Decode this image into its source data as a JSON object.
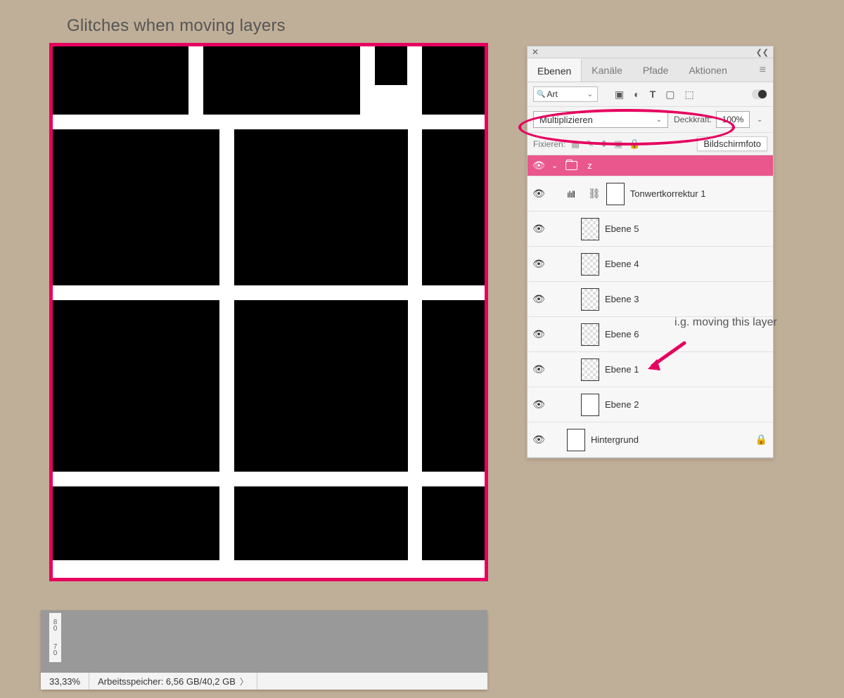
{
  "title": "Glitches when moving layers",
  "panel": {
    "close_glyph": "✕",
    "collapse_glyph": "❮❮",
    "tabs": [
      "Ebenen",
      "Kanäle",
      "Pfade",
      "Aktionen"
    ],
    "active_tab": 0,
    "filter": {
      "search_glyph": "🔍",
      "label": "Art"
    },
    "blend_mode": "Multiplizieren",
    "opacity_label": "Deckkraft:",
    "opacity_value": "100%",
    "lock_label": "Fixieren:",
    "screenshot_chip": "Bildschirmfoto",
    "group_name": "z",
    "layers": {
      "adj": "Tonwertkorrektur 1",
      "l5": "Ebene 5",
      "l4": "Ebene 4",
      "l3": "Ebene 3",
      "l6": "Ebene 6",
      "l1": "Ebene 1",
      "l2": "Ebene 2",
      "bg": "Hintergrund"
    }
  },
  "annotation": "i.g. moving this layer",
  "ruler": {
    "top": "8\n0",
    "bottom": "7\n0"
  },
  "status": {
    "zoom": "33,33%",
    "mem": "Arbeitsspeicher: 6,56 GB/40,2 GB"
  }
}
